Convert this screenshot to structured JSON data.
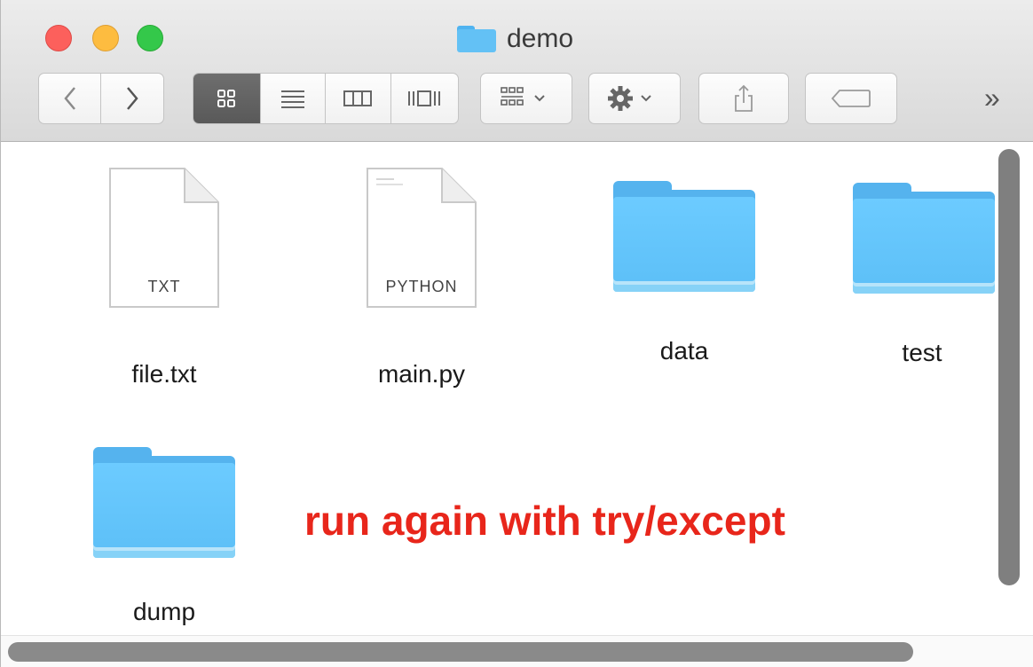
{
  "window": {
    "title": "demo",
    "traffic_lights": [
      "close",
      "minimize",
      "zoom"
    ]
  },
  "toolbar": {
    "nav": [
      {
        "name": "back-button",
        "icon": "chevron-left-icon",
        "glyph": "‹"
      },
      {
        "name": "forward-button",
        "icon": "chevron-right-icon",
        "glyph": "›"
      }
    ],
    "view_modes": [
      {
        "name": "icon-view",
        "icon": "grid-icon",
        "active": true
      },
      {
        "name": "list-view",
        "icon": "list-icon",
        "active": false
      },
      {
        "name": "column-view",
        "icon": "columns-icon",
        "active": false
      },
      {
        "name": "gallery-view",
        "icon": "coverflow-icon",
        "active": false
      }
    ],
    "arrange_icon": "arrange-grid-icon",
    "action_icon": "gear-icon",
    "share_icon": "share-icon",
    "tags_icon": "tag-icon",
    "overflow_glyph": "»"
  },
  "files": [
    {
      "name": "file.txt",
      "kind": "document",
      "type_label": "TXT"
    },
    {
      "name": "main.py",
      "kind": "document",
      "type_label": "PYTHON"
    },
    {
      "name": "data",
      "kind": "folder"
    },
    {
      "name": "test",
      "kind": "folder"
    },
    {
      "name": "dump",
      "kind": "folder"
    }
  ],
  "annotation": "run again with try/except",
  "colors": {
    "folder": "#63c1f5",
    "annotation": "#e8261b",
    "close": "#fc605c",
    "minimize": "#fdbc40",
    "zoom": "#34c84a"
  }
}
